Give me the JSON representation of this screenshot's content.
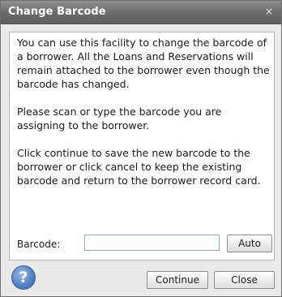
{
  "window": {
    "title": "Change Barcode",
    "close_glyph": "×"
  },
  "message": {
    "paragraph1": "You can use this facility to change the barcode of a borrower. All the Loans and Reservations will remain attached to the borrower even though the barcode has changed.",
    "paragraph2": "Please scan or type the barcode you are assigning to the borrower.",
    "paragraph3": "Click continue to save the new barcode to the borrower or click cancel to keep the existing barcode and return to the borrower record card."
  },
  "barcode": {
    "label": "Barcode:",
    "value": "",
    "auto_label": "Auto"
  },
  "footer": {
    "help_glyph": "?",
    "continue_label": "Continue",
    "close_label": "Close"
  },
  "icons": {
    "help": "help-icon",
    "close": "close-icon"
  }
}
